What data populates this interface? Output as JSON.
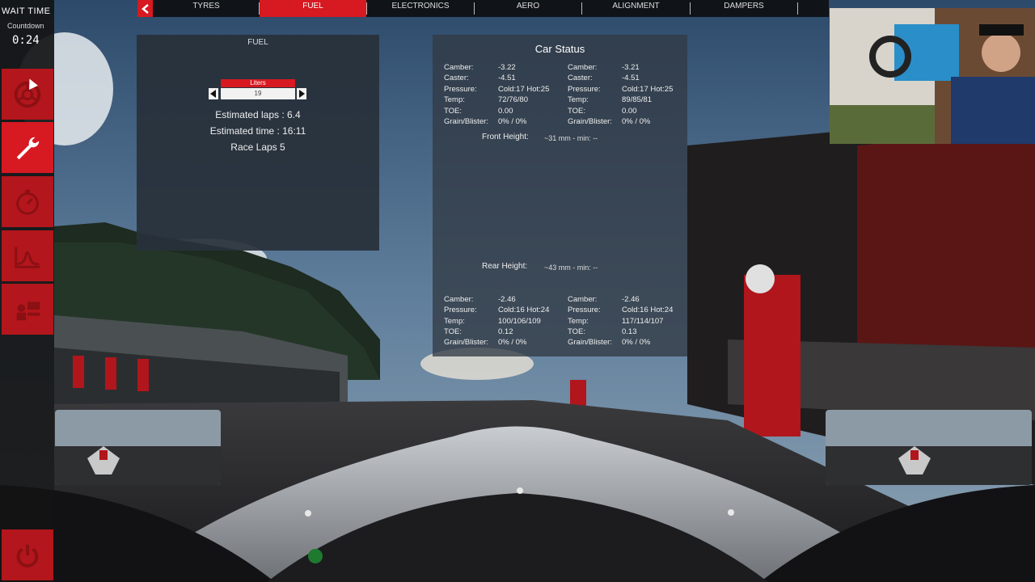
{
  "sidebar": {
    "wait_title": "WAIT TIME",
    "countdown_label": "Countdown",
    "countdown_value": "0:24",
    "buttons": [
      "tyre-icon",
      "wrench-icon",
      "stopwatch-icon",
      "telemetry-icon",
      "pit-crew-icon"
    ],
    "power": "power-icon"
  },
  "tabs": {
    "items": [
      "TYRES",
      "FUEL",
      "ELECTRONICS",
      "AERO",
      "ALIGNMENT",
      "DAMPERS"
    ],
    "active": "FUEL"
  },
  "fuel": {
    "title": "FUEL",
    "liters_label": "Liters",
    "liters_value": "19",
    "estimated_laps": "Estimated laps : 6.4",
    "estimated_time": "Estimated time : 16:11",
    "race_laps": "Race Laps 5"
  },
  "car_status": {
    "title": "Car Status",
    "front_left": [
      {
        "label": "Camber:",
        "value": "-3.22"
      },
      {
        "label": "Caster:",
        "value": "-4.51"
      },
      {
        "label": "Pressure:",
        "value": "Cold:17 Hot:25"
      },
      {
        "label": "Temp:",
        "value": "72/76/80"
      },
      {
        "label": "TOE:",
        "value": "0.00"
      },
      {
        "label": "Grain/Blister:",
        "value": "0% / 0%"
      }
    ],
    "front_right": [
      {
        "label": "Camber:",
        "value": "-3.21"
      },
      {
        "label": "Caster:",
        "value": "-4.51"
      },
      {
        "label": "Pressure:",
        "value": "Cold:17 Hot:25"
      },
      {
        "label": "Temp:",
        "value": "89/85/81"
      },
      {
        "label": "TOE:",
        "value": "0.00"
      },
      {
        "label": "Grain/Blister:",
        "value": "0% / 0%"
      }
    ],
    "front_height_label": "Front Height:",
    "front_height_value": "~31 mm - min: --",
    "rear_height_label": "Rear Height:",
    "rear_height_value": "~43 mm - min: --",
    "rear_left": [
      {
        "label": "Camber:",
        "value": "-2.46"
      },
      {
        "label": "Pressure:",
        "value": "Cold:16 Hot:24"
      },
      {
        "label": "Temp:",
        "value": "100/106/109"
      },
      {
        "label": "TOE:",
        "value": "0.12"
      },
      {
        "label": "Grain/Blister:",
        "value": "0% / 0%"
      }
    ],
    "rear_right": [
      {
        "label": "Camber:",
        "value": "-2.46"
      },
      {
        "label": "Pressure:",
        "value": "Cold:16 Hot:24"
      },
      {
        "label": "Temp:",
        "value": "117/114/107"
      },
      {
        "label": "TOE:",
        "value": "0.13"
      },
      {
        "label": "Grain/Blister:",
        "value": "0% / 0%"
      }
    ]
  },
  "colors": {
    "accent": "#d71921",
    "panel": "#28303a"
  }
}
